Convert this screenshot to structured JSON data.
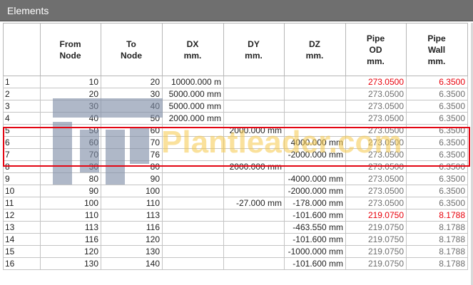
{
  "window": {
    "title": "Elements"
  },
  "grid": {
    "columns": [
      "",
      "From\nNode",
      "To\nNode",
      "DX\nmm.",
      "DY\nmm.",
      "DZ\nmm.",
      "Pipe\nOD\nmm.",
      "Pipe\nWall\nmm."
    ],
    "rows": [
      {
        "id": "1",
        "from": "10",
        "to": "20",
        "dx": "10000.000 m",
        "dy": "",
        "dz": "",
        "od": "273.0500",
        "wall": "6.3500",
        "od_red": true,
        "wall_red": true
      },
      {
        "id": "2",
        "from": "20",
        "to": "30",
        "dx": "5000.000 mm",
        "dy": "",
        "dz": "",
        "od": "273.0500",
        "wall": "6.3500",
        "od_red": false,
        "wall_red": false
      },
      {
        "id": "3",
        "from": "30",
        "to": "40",
        "dx": "5000.000 mm",
        "dy": "",
        "dz": "",
        "od": "273.0500",
        "wall": "6.3500",
        "od_red": false,
        "wall_red": false
      },
      {
        "id": "4",
        "from": "40",
        "to": "50",
        "dx": "2000.000 mm",
        "dy": "",
        "dz": "",
        "od": "273.0500",
        "wall": "6.3500",
        "od_red": false,
        "wall_red": false
      },
      {
        "id": "5",
        "from": "50",
        "to": "60",
        "dx": "",
        "dy": "2000.000 mm",
        "dz": "",
        "od": "273.0500",
        "wall": "6.3500",
        "od_red": false,
        "wall_red": false
      },
      {
        "id": "6",
        "from": "60",
        "to": "70",
        "dx": "",
        "dy": "",
        "dz": "4000.000 mm",
        "od": "273.0500",
        "wall": "6.3500",
        "od_red": false,
        "wall_red": false
      },
      {
        "id": "7",
        "from": "70",
        "to": "76",
        "dx": "",
        "dy": "",
        "dz": "-2000.000 mm",
        "od": "273.0500",
        "wall": "6.3500",
        "od_red": false,
        "wall_red": false
      },
      {
        "id": "8",
        "from": "30",
        "to": "80",
        "dx": "",
        "dy": "2000.000 mm",
        "dz": "",
        "od": "273.0500",
        "wall": "6.3500",
        "od_red": false,
        "wall_red": false
      },
      {
        "id": "9",
        "from": "80",
        "to": "90",
        "dx": "",
        "dy": "",
        "dz": "-4000.000 mm",
        "od": "273.0500",
        "wall": "6.3500",
        "od_red": false,
        "wall_red": false
      },
      {
        "id": "10",
        "from": "90",
        "to": "100",
        "dx": "",
        "dy": "",
        "dz": "-2000.000 mm",
        "od": "273.0500",
        "wall": "6.3500",
        "od_red": false,
        "wall_red": false
      },
      {
        "id": "11",
        "from": "100",
        "to": "110",
        "dx": "",
        "dy": "-27.000 mm",
        "dz": "-178.000 mm",
        "od": "273.0500",
        "wall": "6.3500",
        "od_red": false,
        "wall_red": false
      },
      {
        "id": "12",
        "from": "110",
        "to": "113",
        "dx": "",
        "dy": "",
        "dz": "-101.600 mm",
        "od": "219.0750",
        "wall": "8.1788",
        "od_red": true,
        "wall_red": true
      },
      {
        "id": "13",
        "from": "113",
        "to": "116",
        "dx": "",
        "dy": "",
        "dz": "-463.550 mm",
        "od": "219.0750",
        "wall": "8.1788",
        "od_red": false,
        "wall_red": false
      },
      {
        "id": "14",
        "from": "116",
        "to": "120",
        "dx": "",
        "dy": "",
        "dz": "-101.600 mm",
        "od": "219.0750",
        "wall": "8.1788",
        "od_red": false,
        "wall_red": false
      },
      {
        "id": "15",
        "from": "120",
        "to": "130",
        "dx": "",
        "dy": "",
        "dz": "-1000.000 mm",
        "od": "219.0750",
        "wall": "8.1788",
        "od_red": false,
        "wall_red": false
      },
      {
        "id": "16",
        "from": "130",
        "to": "140",
        "dx": "",
        "dy": "",
        "dz": "-101.600 mm",
        "od": "219.0750",
        "wall": "8.1788",
        "od_red": false,
        "wall_red": false
      }
    ]
  },
  "watermark": {
    "text": "Plantleader.com"
  },
  "colors": {
    "highlight_box": "#e30613",
    "red_value": "#e8000b",
    "grey_value": "#6e6e6e",
    "titlebar": "#6f6f6f"
  }
}
